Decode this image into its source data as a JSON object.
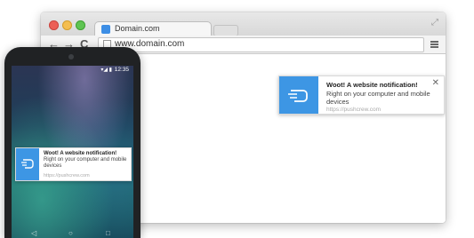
{
  "browser": {
    "tab_title": "Domain.com",
    "url": "www.domain.com",
    "nav": {
      "back": "←",
      "forward": "→",
      "reload": "C"
    }
  },
  "desktop_notification": {
    "title": "Woot! A website notification!",
    "body": "Right on your computer and mobile devices",
    "url": "https://pushcrew.com",
    "close": "✕",
    "icon": "message-icon",
    "accent": "#3d96e4"
  },
  "phone": {
    "status_time": "12:35",
    "status_icons": "▾◢ ▮",
    "notification": {
      "title": "Woot! A website notification!",
      "body": "Right on your computer and mobile devices",
      "url": "https://pushcrew.com",
      "icon": "message-icon"
    }
  },
  "colors": {
    "traffic_red": "#ec5f57",
    "traffic_yellow": "#f4be4f",
    "traffic_green": "#5fc452",
    "notification_accent": "#3d96e4"
  }
}
